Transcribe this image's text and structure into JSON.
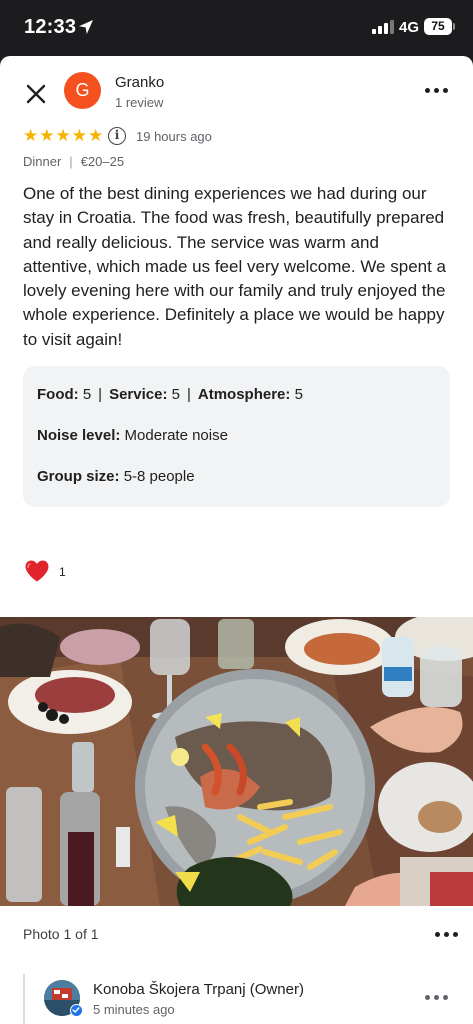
{
  "status_bar": {
    "time": "12:33",
    "network": "4G",
    "battery": "75"
  },
  "review": {
    "reviewer_initial": "G",
    "reviewer_name": "Granko",
    "reviewer_count": "1 review",
    "rating": 5,
    "time_ago": "19 hours ago",
    "meal_type": "Dinner",
    "price_range": "€20–25",
    "text": "One of the best dining experiences we had during our stay in Croatia. The food was fresh, beautifully prepared and really delicious. The service was warm and attentive, which made us feel very welcome. We spent a lovely evening here with our family and truly enjoyed the whole experience. Definitely a place we would be happy to visit again!",
    "details": {
      "food_label": "Food:",
      "food_value": "5",
      "service_label": "Service:",
      "service_value": "5",
      "atmosphere_label": "Atmosphere:",
      "atmosphere_value": "5",
      "noise_label": "Noise level:",
      "noise_value": "Moderate noise",
      "group_label": "Group size:",
      "group_value": "5-8 people"
    },
    "likes": "1"
  },
  "photo": {
    "caption": "Photo 1 of 1"
  },
  "owner_reply": {
    "name": "Konoba Škojera Trpanj (Owner)",
    "time_ago": "5 minutes ago"
  },
  "icons": {
    "close": "close-icon",
    "more": "more-horizontal-icon",
    "info": "info-icon",
    "heart": "heart-icon",
    "star": "star-icon",
    "verified": "verified-badge-icon"
  },
  "colors": {
    "avatar": "#f4511e",
    "star": "#f6b400",
    "heart": "#e0242b",
    "badge": "#1a73e8"
  }
}
